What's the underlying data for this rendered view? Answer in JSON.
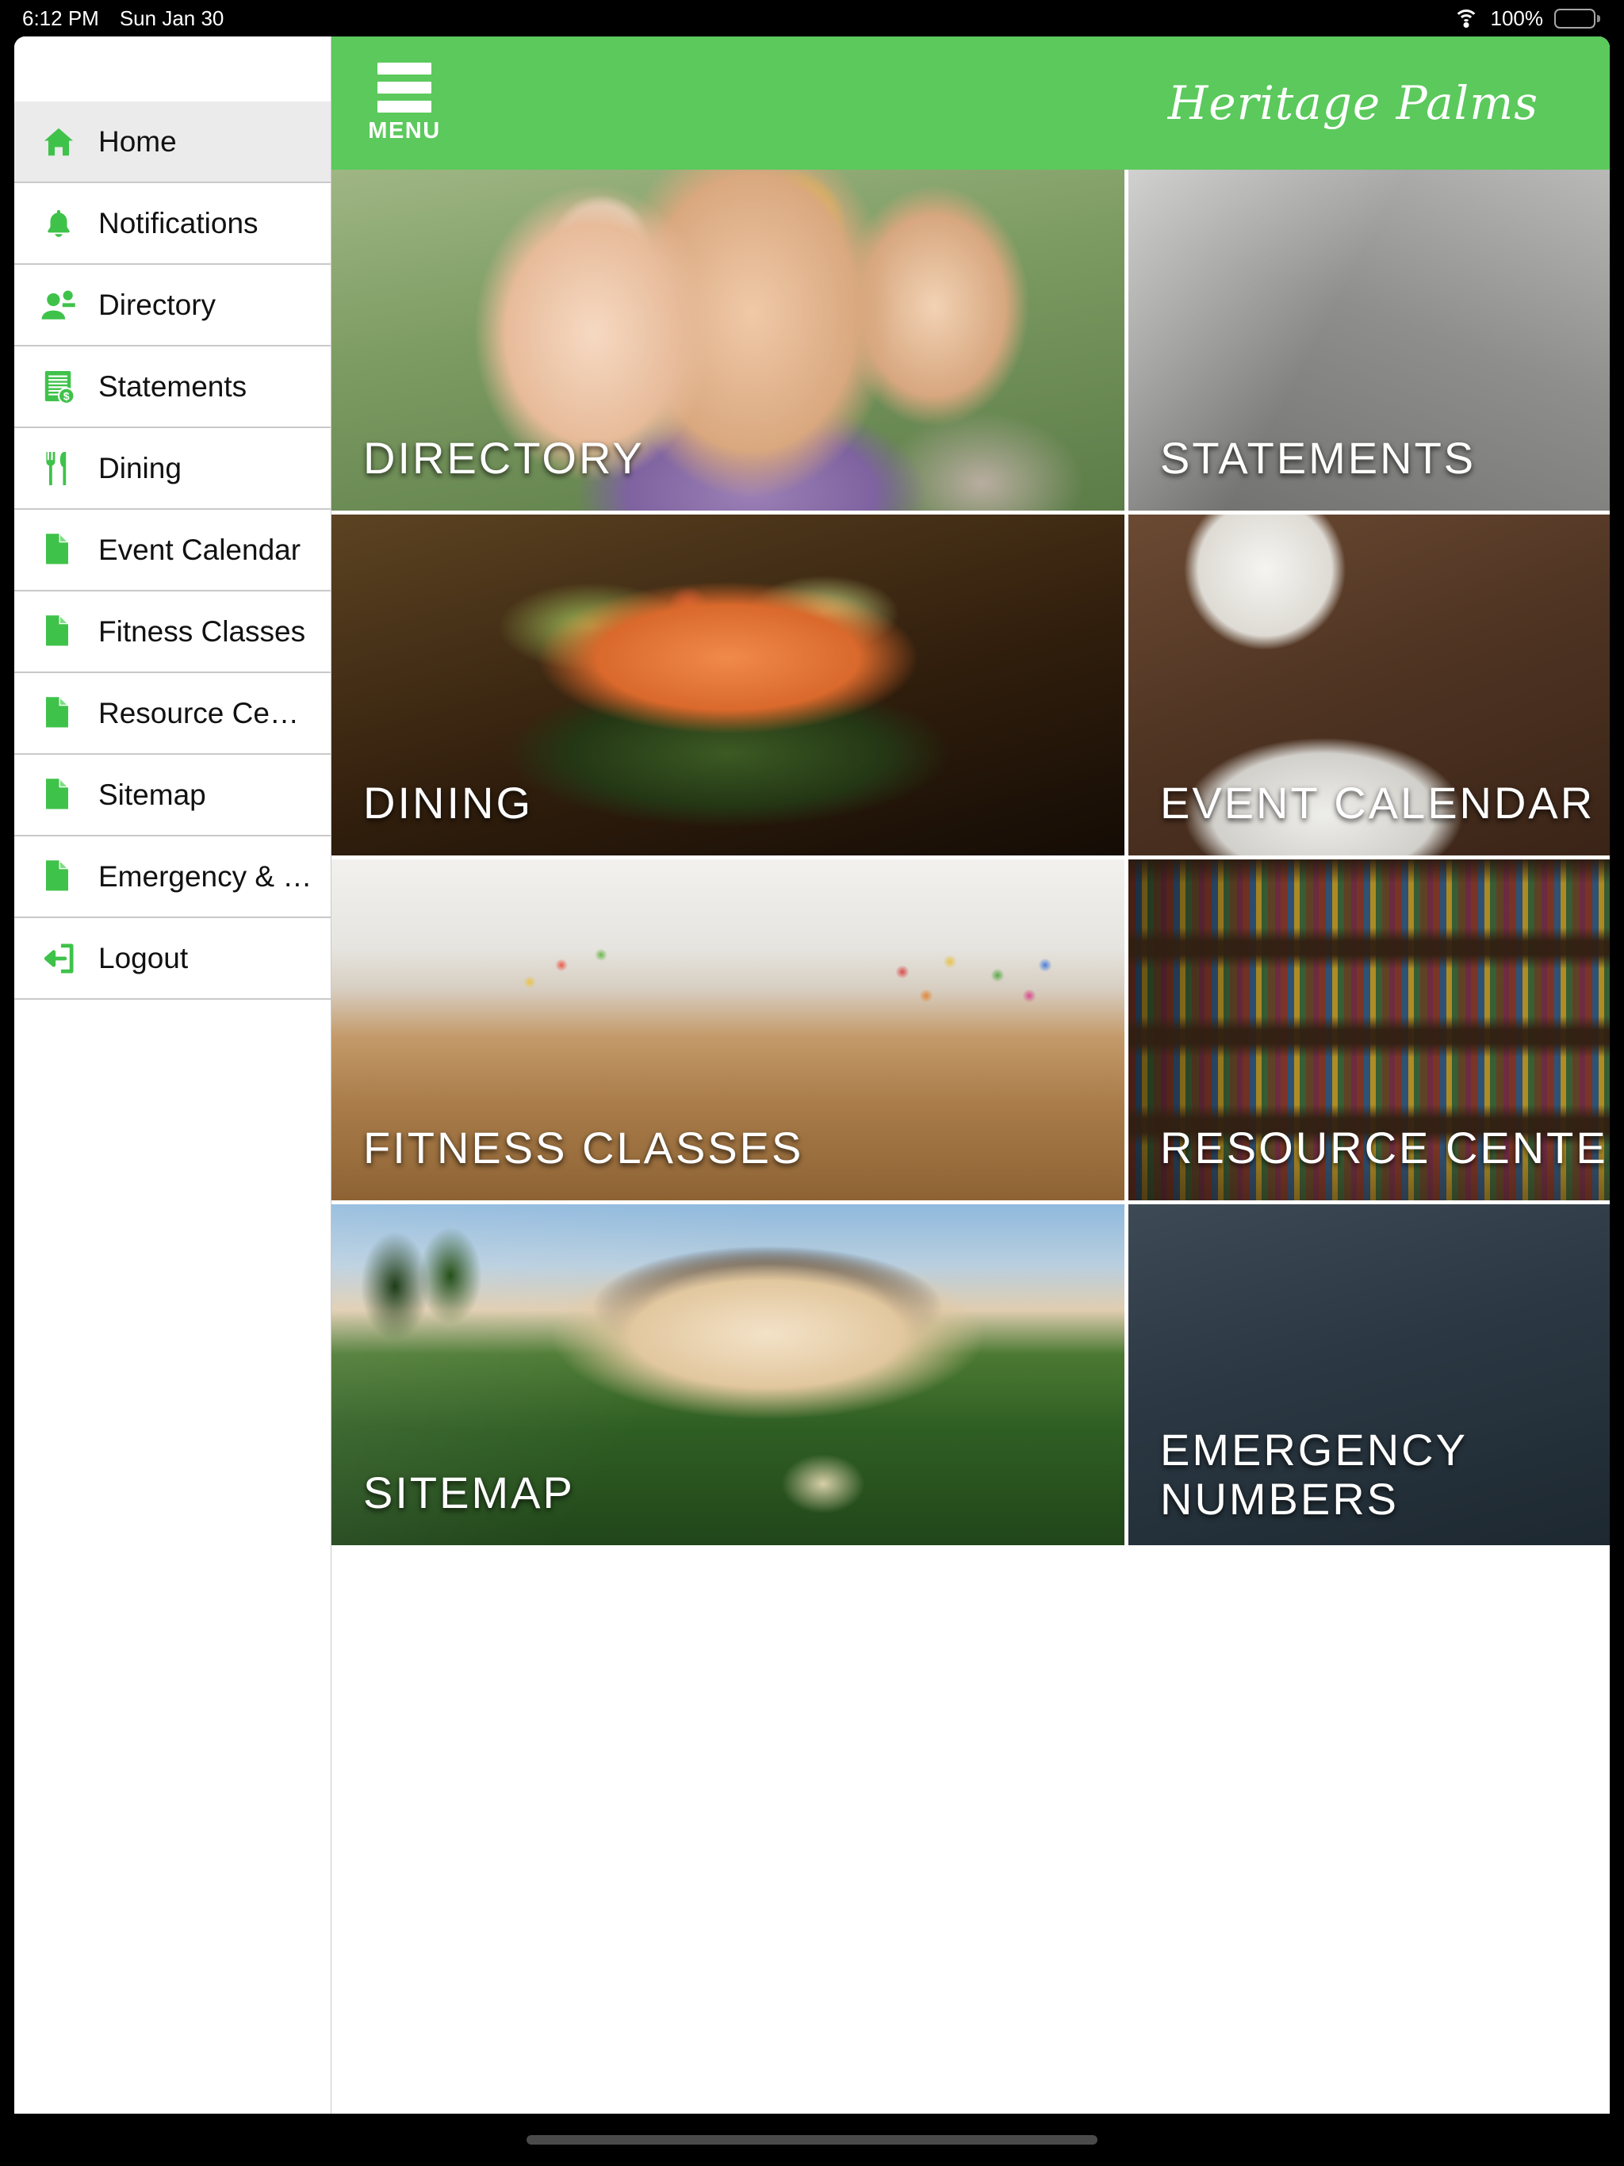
{
  "status_bar": {
    "time": "6:12 PM",
    "date": "Sun Jan 30",
    "wifi_icon": "wifi-icon",
    "battery_percent": "100%",
    "battery_icon": "battery-full-icon"
  },
  "sidebar": {
    "items": [
      {
        "label": "Home",
        "icon": "home-icon",
        "selected": true
      },
      {
        "label": "Notifications",
        "icon": "bell-icon",
        "selected": false
      },
      {
        "label": "Directory",
        "icon": "people-icon",
        "selected": false
      },
      {
        "label": "Statements",
        "icon": "statement-doc-icon",
        "selected": false
      },
      {
        "label": "Dining",
        "icon": "fork-knife-icon",
        "selected": false
      },
      {
        "label": "Event Calendar",
        "icon": "page-icon",
        "selected": false
      },
      {
        "label": "Fitness Classes",
        "icon": "page-icon",
        "selected": false
      },
      {
        "label": "Resource Center",
        "icon": "page-icon",
        "selected": false
      },
      {
        "label": "Sitemap",
        "icon": "page-icon",
        "selected": false
      },
      {
        "label": "Emergency & Importa…",
        "icon": "page-icon",
        "selected": false
      },
      {
        "label": "Logout",
        "icon": "logout-icon",
        "selected": false
      }
    ]
  },
  "header": {
    "menu_label": "MENU",
    "menu_icon": "hamburger-icon",
    "brand": "Heritage Palms",
    "background_color": "#5BC95C"
  },
  "tiles": [
    {
      "label": "DIRECTORY",
      "art": "art-directory",
      "column": "left"
    },
    {
      "label": "STATEMENTS",
      "art": "art-statements",
      "column": "right"
    },
    {
      "label": "DINING",
      "art": "art-dining",
      "column": "left"
    },
    {
      "label": "EVENT CALENDAR",
      "art": "art-event",
      "column": "right"
    },
    {
      "label": "FITNESS CLASSES",
      "art": "art-fitness",
      "column": "left"
    },
    {
      "label": "RESOURCE CENTER",
      "art": "art-resource",
      "column": "right"
    },
    {
      "label": "SITEMAP",
      "art": "art-sitemap",
      "column": "left"
    },
    {
      "label": "EMERGENCY NUMBERS",
      "art": "art-emergency",
      "column": "right"
    }
  ],
  "colors": {
    "accent_green": "#3FC24A",
    "header_green": "#5BC95C",
    "selected_row": "#EBEBEB",
    "divider": "#C9C9C9"
  }
}
